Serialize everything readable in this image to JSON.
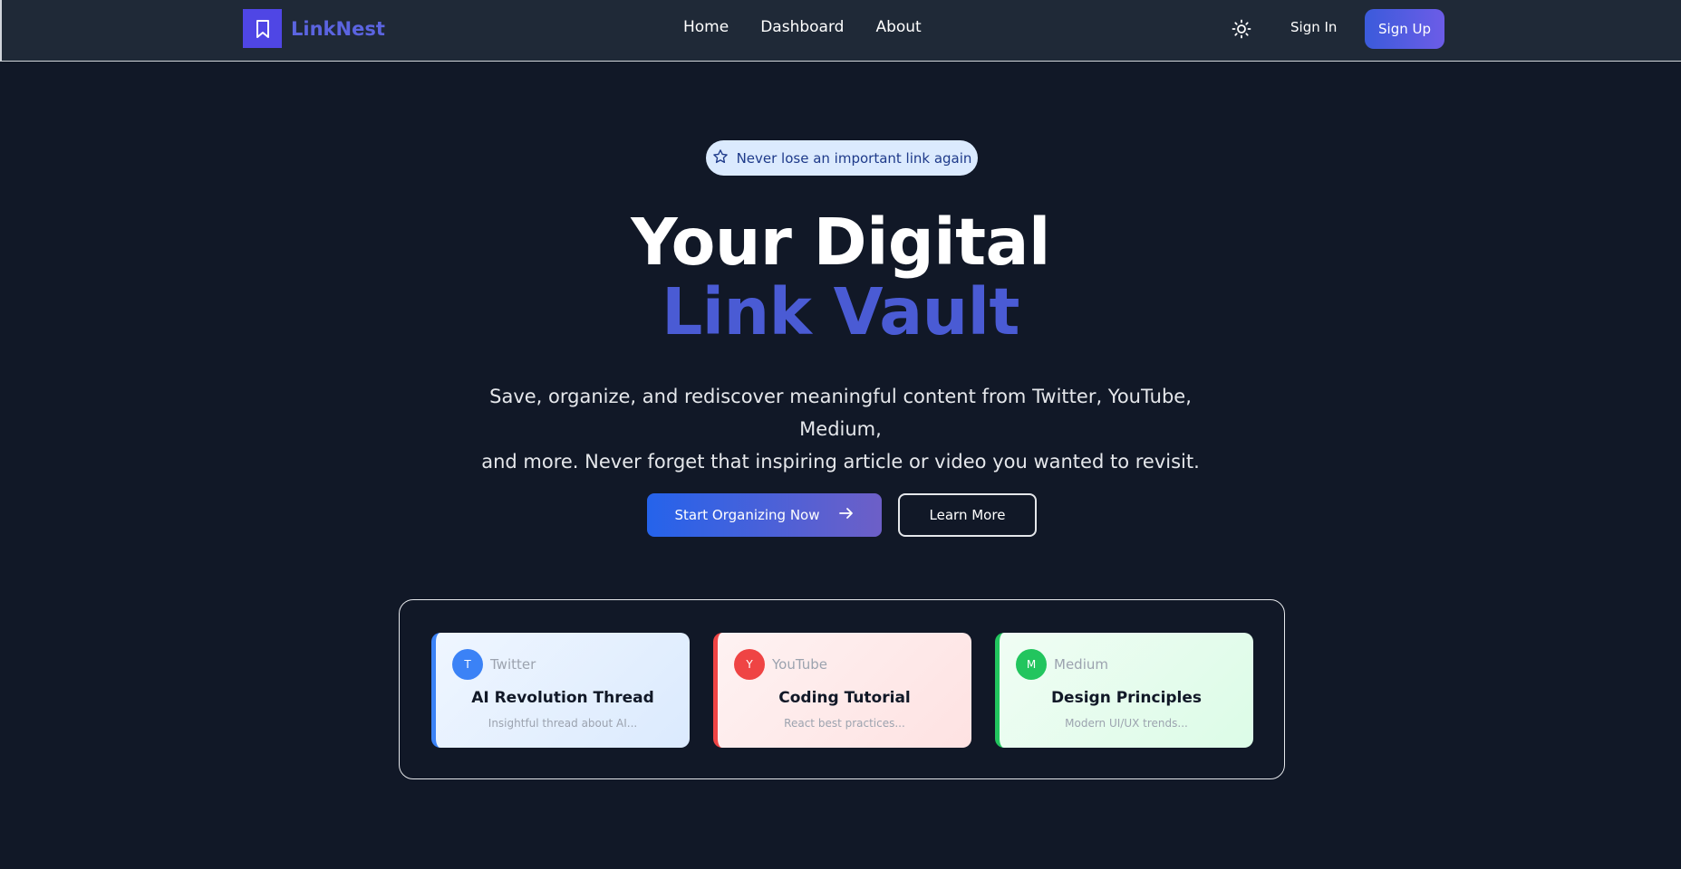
{
  "nav": {
    "brand": "LinkNest",
    "links": [
      "Home",
      "Dashboard",
      "About"
    ],
    "signin_label": "Sign In",
    "signup_label": "Sign Up"
  },
  "hero": {
    "badge": "Never lose an important link again",
    "headline_line1": "Your Digital",
    "headline_line2": "Link Vault",
    "subtext_line1": "Save, organize, and rediscover meaningful content from Twitter, YouTube, Medium,",
    "subtext_line2": "and more. Never forget that inspiring article or video you wanted to revisit.",
    "cta_primary": "Start Organizing Now",
    "cta_secondary": "Learn More"
  },
  "cards": [
    {
      "initial": "T",
      "source": "Twitter",
      "title": "AI Revolution Thread",
      "desc": "Insightful thread about AI...",
      "color": "#3b82f6"
    },
    {
      "initial": "Y",
      "source": "YouTube",
      "title": "Coding Tutorial",
      "desc": "React best practices...",
      "color": "#ef4444"
    },
    {
      "initial": "M",
      "source": "Medium",
      "title": "Design Principles",
      "desc": "Modern UI/UX trends...",
      "color": "#22c55e"
    }
  ],
  "colors": {
    "background": "#111827",
    "navbar": "#1f2937",
    "brand": "#5b64e0",
    "accent": "#4a5bd4"
  },
  "icons": {
    "logo": "bookmark-icon",
    "theme": "sun-icon",
    "badge": "star-icon",
    "cta": "arrow-right-icon"
  }
}
